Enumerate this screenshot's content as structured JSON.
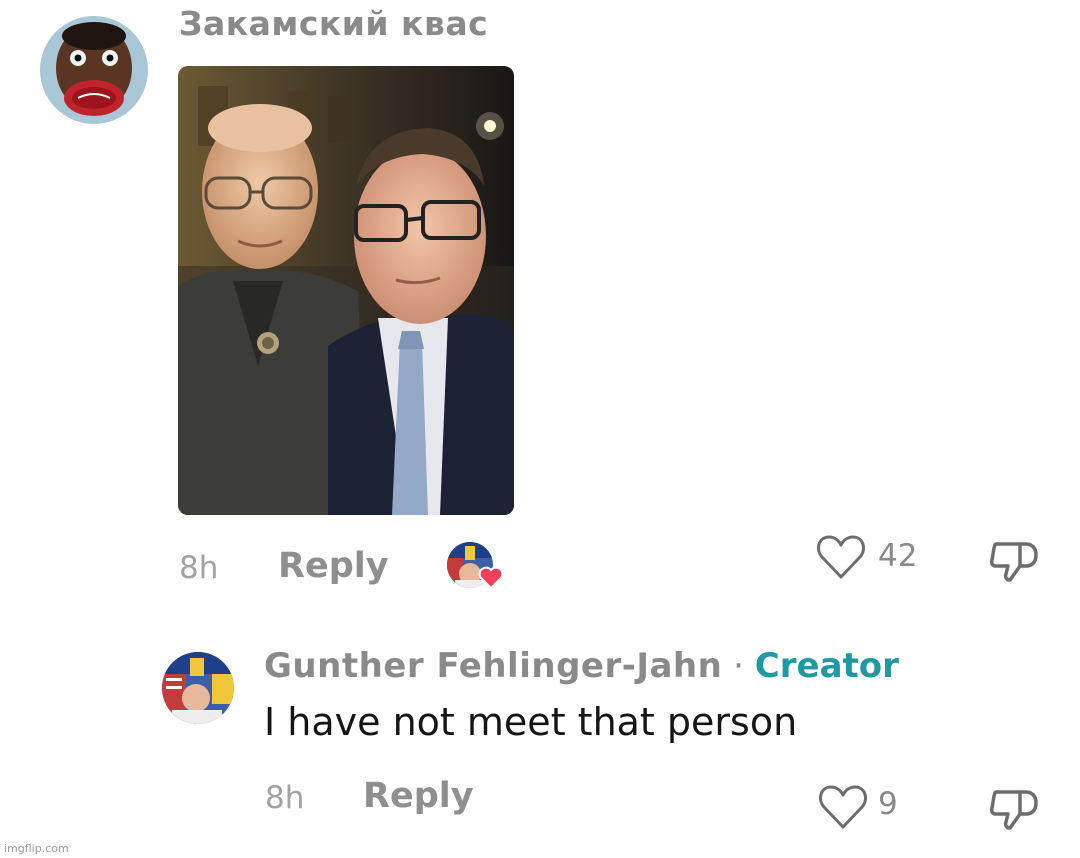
{
  "comment1": {
    "avatar_icon": "user-avatar-icon",
    "username": "Закамский квас",
    "photo_icon": "photo-attachment",
    "time": "8h",
    "reply_label": "Reply",
    "creator_liked_icon": "creator-heart-avatar-icon",
    "like_count": "42"
  },
  "comment2": {
    "avatar_icon": "creator-avatar-icon",
    "username": "Gunther Fehlinger-Jahn",
    "separator": "·",
    "badge": "Creator",
    "text": "I have not meet that person",
    "time": "8h",
    "reply_label": "Reply",
    "like_count": "9"
  },
  "watermark": "imgflip.com",
  "colors": {
    "creator_badge": "#1f9aa3",
    "heart_badge": "#f0405a",
    "muted_text": "#8a8a8a"
  }
}
